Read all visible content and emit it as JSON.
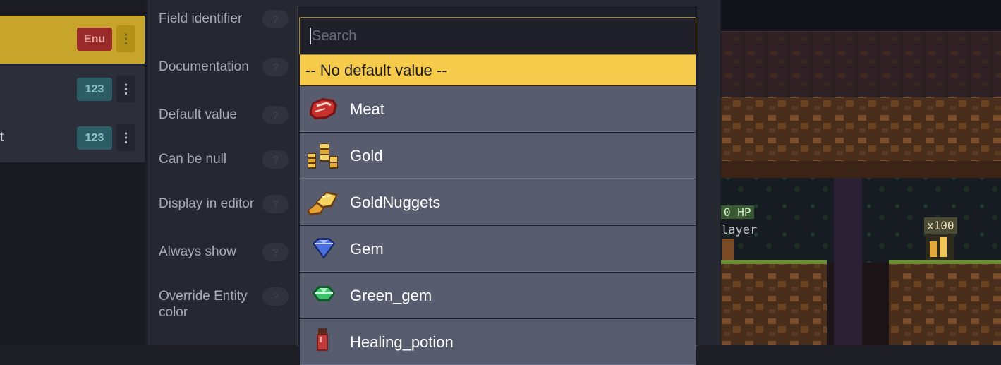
{
  "fields_list": {
    "rows": [
      {
        "label": "",
        "type_badge": "Enu",
        "selected": true
      },
      {
        "label": "",
        "type_badge": "123",
        "selected": false
      },
      {
        "label": "t",
        "type_badge": "123",
        "selected": false
      }
    ]
  },
  "properties": {
    "field_identifier": "Field identifier",
    "documentation": "Documentation",
    "default_value": "Default value",
    "can_be_null": "Can be null",
    "display_in_editor": "Display in editor",
    "always_show": "Always show",
    "override_entity_color": "Override Entity color",
    "help_glyph": "?"
  },
  "dropdown": {
    "search_placeholder": "Search",
    "search_value": "",
    "no_default_label": "-- No default value --",
    "options": [
      {
        "label": "Meat",
        "icon": "meat-icon"
      },
      {
        "label": "Gold",
        "icon": "gold-coins-icon"
      },
      {
        "label": "GoldNuggets",
        "icon": "gold-nuggets-icon"
      },
      {
        "label": "Gem",
        "icon": "blue-gem-icon"
      },
      {
        "label": "Green_gem",
        "icon": "green-gem-icon"
      },
      {
        "label": "Healing_potion",
        "icon": "potion-icon"
      }
    ]
  },
  "scene": {
    "hp_label": "0 HP",
    "player_label": "layer",
    "pickup_label": "x100"
  },
  "colors": {
    "selected_row": "#c7a52a",
    "highlight": "#f6cb4c",
    "option_bg": "#585c6f"
  }
}
